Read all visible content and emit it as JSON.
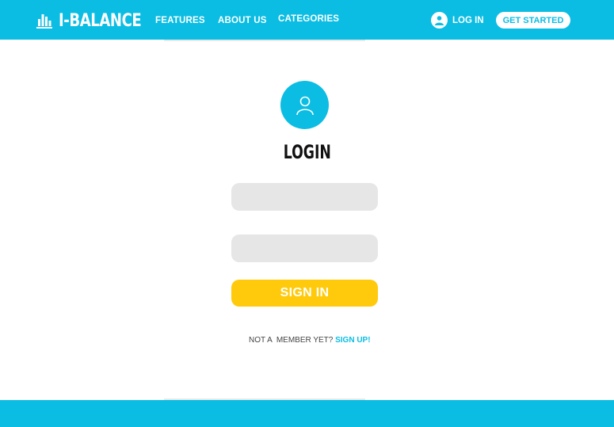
{
  "brand": {
    "name": "I-BALANCE",
    "logo_icon": "building-icon"
  },
  "nav": {
    "features": "FEATURES",
    "about": "ABOUT US",
    "categories": "CATEGORIES"
  },
  "header_actions": {
    "login_label": "LOG IN",
    "login_icon": "user-icon",
    "get_started_label": "GET STARTED"
  },
  "login": {
    "avatar_icon": "user-icon",
    "title": "LOGIN",
    "username_placeholder": "",
    "password_placeholder": "",
    "submit_label": "SIGN IN",
    "signup_prompt": "NOT A  MEMBER YET? ",
    "signup_link": "SIGN UP!"
  },
  "colors": {
    "primary": "#0bbde3",
    "accent": "#ffca0b",
    "field_bg": "#e6e6e6"
  }
}
